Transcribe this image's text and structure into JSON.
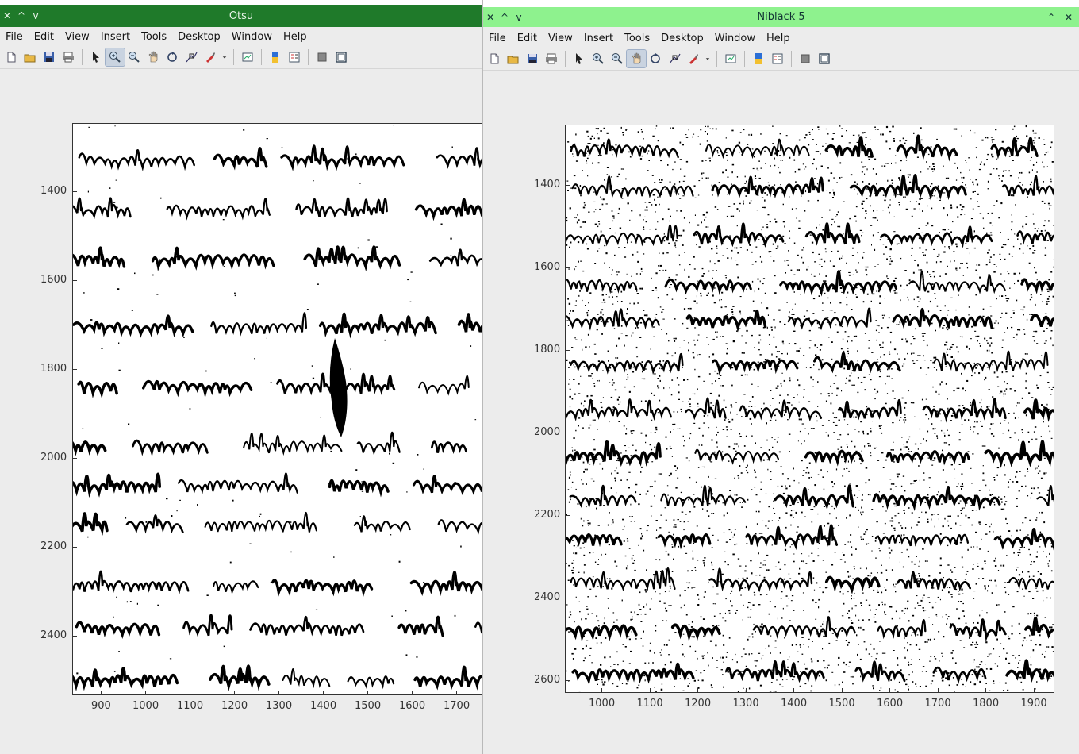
{
  "windows": [
    {
      "id": "left",
      "title": "Otsu",
      "menu": [
        "File",
        "Edit",
        "View",
        "Insert",
        "Tools",
        "Desktop",
        "Window",
        "Help"
      ],
      "active_tool": "zoom-in",
      "y_ticks": [
        "1400",
        "1600",
        "1800",
        "2000",
        "2200",
        "2400"
      ],
      "x_ticks": [
        "900",
        "1000",
        "1100",
        "1200",
        "1300",
        "1400",
        "1500",
        "1600",
        "1700"
      ],
      "ink_color": "#000000"
    },
    {
      "id": "right",
      "title": "Niblack 5",
      "menu": [
        "File",
        "Edit",
        "View",
        "Insert",
        "Tools",
        "Desktop",
        "Window",
        "Help"
      ],
      "active_tool": "pan",
      "y_ticks": [
        "1400",
        "1600",
        "1800",
        "2000",
        "2200",
        "2400",
        "2600"
      ],
      "x_ticks": [
        "1000",
        "1100",
        "1200",
        "1300",
        "1400",
        "1500",
        "1600",
        "1700",
        "1800",
        "1900"
      ],
      "ink_color": "#000000"
    }
  ],
  "colors": {
    "left_titlebar": "#1f7a2a",
    "right_titlebar": "#8ef28e",
    "window_bg": "#ececec"
  },
  "toolbar_icons": [
    "new-figure-icon",
    "open-file-icon",
    "save-icon",
    "print-icon",
    "pointer-icon",
    "zoom-in-icon",
    "zoom-out-icon",
    "pan-icon",
    "rotate-icon",
    "data-cursor-icon",
    "brush-icon",
    "dropdown-icon",
    "link-plot-icon",
    "colorbar-icon",
    "legend-icon",
    "hide-tools-icon",
    "show-tools-icon"
  ]
}
